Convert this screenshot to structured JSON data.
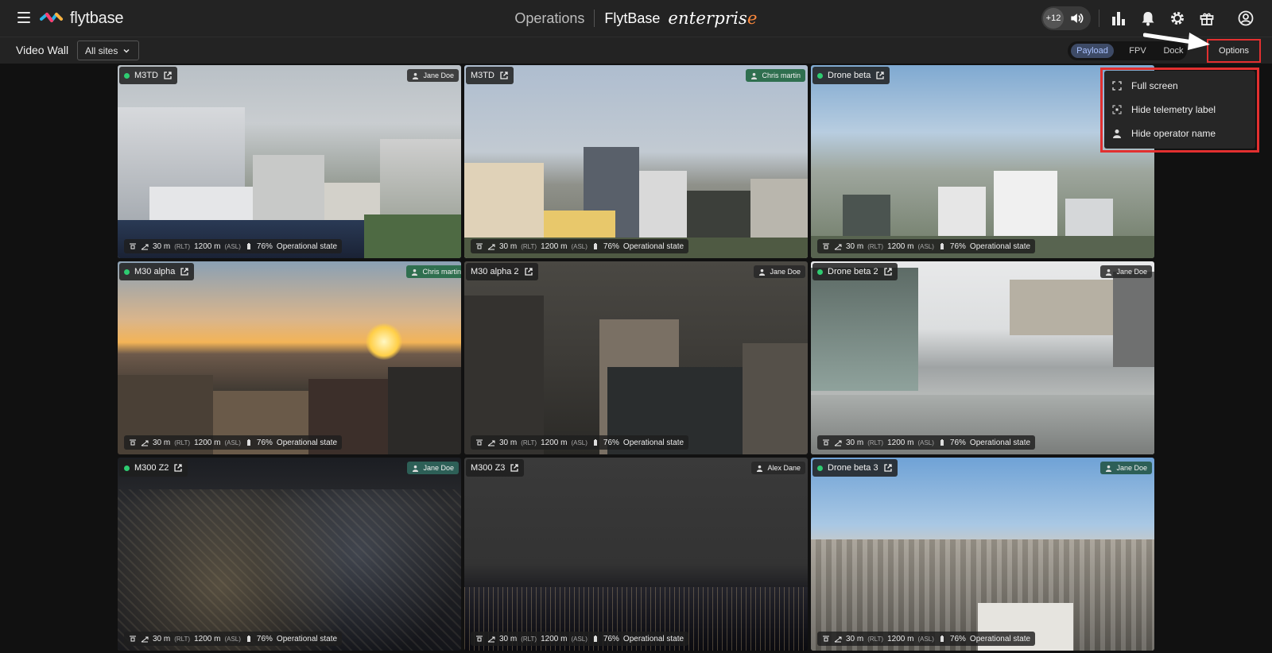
{
  "header": {
    "logo_text": "flytbase",
    "section_title": "Operations",
    "brand": "FlytBase",
    "edition_main": "enterpris",
    "edition_accent": "e",
    "audio_count": "+12"
  },
  "subbar": {
    "title": "Video Wall",
    "site_select": "All sites",
    "modes": [
      "Payload",
      "FPV",
      "Dock"
    ],
    "active_mode": "Payload",
    "options_label": "Options"
  },
  "options_menu": [
    {
      "label": "Full screen",
      "icon": "fullscreen-icon"
    },
    {
      "label": "Hide telemetry label",
      "icon": "telemetry-icon"
    },
    {
      "label": "Hide operator name",
      "icon": "person-icon"
    }
  ],
  "telemetry": {
    "rlt_alt": "30 m",
    "rlt_unit": "(RLT)",
    "asl_alt": "1200 m",
    "asl_unit": "(ASL)",
    "battery": "76%",
    "state": "Operational state"
  },
  "feeds": [
    {
      "drone": "M3TD",
      "operator": "Jane Doe",
      "scene": "city-day"
    },
    {
      "drone": "M3TD",
      "operator": "Chris martin",
      "scene": "city-day2"
    },
    {
      "drone": "Drone beta",
      "operator": "",
      "scene": "city-wide"
    },
    {
      "drone": "M30 alpha",
      "operator": "Chris martin",
      "scene": "sunset"
    },
    {
      "drone": "M30 alpha 2",
      "operator": "Jane Doe",
      "scene": "dusk"
    },
    {
      "drone": "Drone beta 2",
      "operator": "Jane Doe",
      "scene": "rooftop"
    },
    {
      "drone": "M300 Z2",
      "operator": "Jane Doe",
      "scene": "night"
    },
    {
      "drone": "M300 Z3",
      "operator": "Alex Dane",
      "scene": "night-far"
    },
    {
      "drone": "Drone beta 3",
      "operator": "Jane Doe",
      "scene": "city-clear"
    }
  ]
}
